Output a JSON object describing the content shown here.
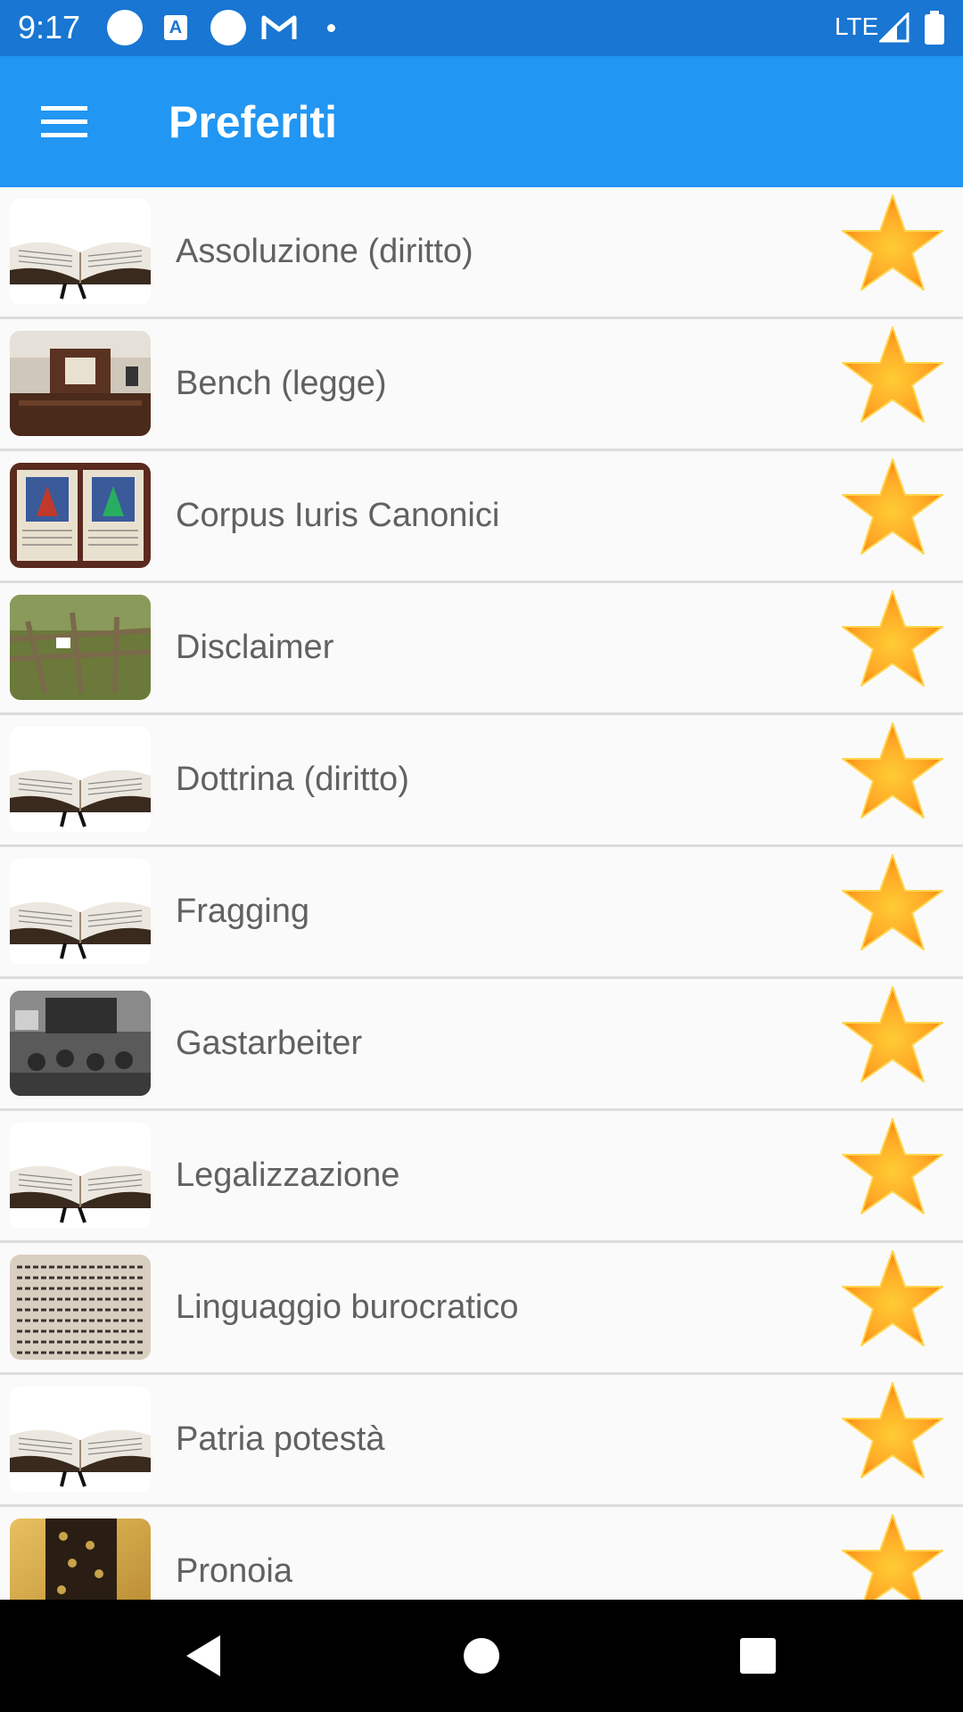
{
  "status_bar": {
    "time": "9:17",
    "network": "LTE",
    "icons": [
      "notification-circle-icon",
      "a-app-icon",
      "notification-circle-icon",
      "gmail-icon",
      "dot-icon",
      "signal-icon",
      "battery-icon"
    ]
  },
  "app_bar": {
    "title": "Preferiti",
    "menu_icon": "hamburger-menu-icon"
  },
  "favorites": [
    {
      "label": "Assoluzione (diritto)",
      "thumb": "book",
      "starred": true
    },
    {
      "label": "Bench (legge)",
      "thumb": "courtroom",
      "starred": true
    },
    {
      "label": "Corpus Iuris Canonici",
      "thumb": "manuscript",
      "starred": true
    },
    {
      "label": "Disclaimer",
      "thumb": "fence",
      "starred": true
    },
    {
      "label": "Dottrina (diritto)",
      "thumb": "book",
      "starred": true
    },
    {
      "label": "Fragging",
      "thumb": "book",
      "starred": true
    },
    {
      "label": "Gastarbeiter",
      "thumb": "classroom",
      "starred": true
    },
    {
      "label": "Legalizzazione",
      "thumb": "book",
      "starred": true
    },
    {
      "label": "Linguaggio burocratico",
      "thumb": "text-page",
      "starred": true
    },
    {
      "label": "Patria potestà",
      "thumb": "book",
      "starred": true
    },
    {
      "label": "Pronoia",
      "thumb": "golden-document",
      "starred": true
    }
  ],
  "nav_bar": {
    "back_icon": "back-triangle-icon",
    "home_icon": "home-circle-icon",
    "recents_icon": "recents-square-icon"
  },
  "colors": {
    "status_bar": "#1976d2",
    "app_bar": "#2196f3",
    "star": "#ffa726",
    "label_text": "#616161"
  }
}
